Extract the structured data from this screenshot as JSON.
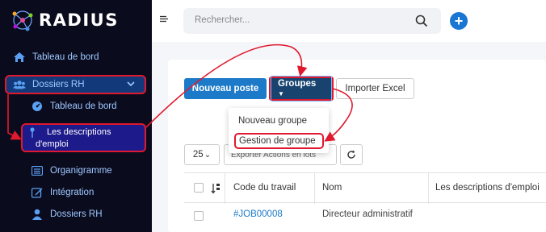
{
  "brand": {
    "name": "RADIUS"
  },
  "sidebar": {
    "items": [
      {
        "label": "Tableau de bord",
        "icon": "home-icon"
      },
      {
        "label": "Dossiers RH",
        "icon": "users-icon"
      },
      {
        "label": "Tableau de bord",
        "icon": "dashboard-icon"
      },
      {
        "label_line1": "Les descriptions",
        "label_line2": "d'emploi",
        "icon": "pin-icon"
      },
      {
        "label": "Organigramme",
        "icon": "list-icon"
      },
      {
        "label": "Intégration",
        "icon": "edit-icon"
      },
      {
        "label": "Dossiers RH",
        "icon": "user-icon"
      }
    ]
  },
  "header": {
    "search_placeholder": "Rechercher..."
  },
  "toolbar": {
    "new_label": "Nouveau poste",
    "groupes_label": "Groupes",
    "import_label": "Importer Excel",
    "page_size": "25",
    "export_label": "Exporter Actions en lots"
  },
  "dropdown": {
    "items": [
      "Nouveau groupe",
      "Gestion de groupe"
    ]
  },
  "table": {
    "columns": [
      "Code du travail",
      "Nom",
      "Les descriptions d'emploi"
    ],
    "rows": [
      {
        "code": "#JOB00008",
        "name": "Directeur administratif"
      }
    ]
  },
  "colors": {
    "accent": "#1c7ac8",
    "highlight": "#e0192e",
    "sidebar_bg": "#0b0b1e"
  }
}
